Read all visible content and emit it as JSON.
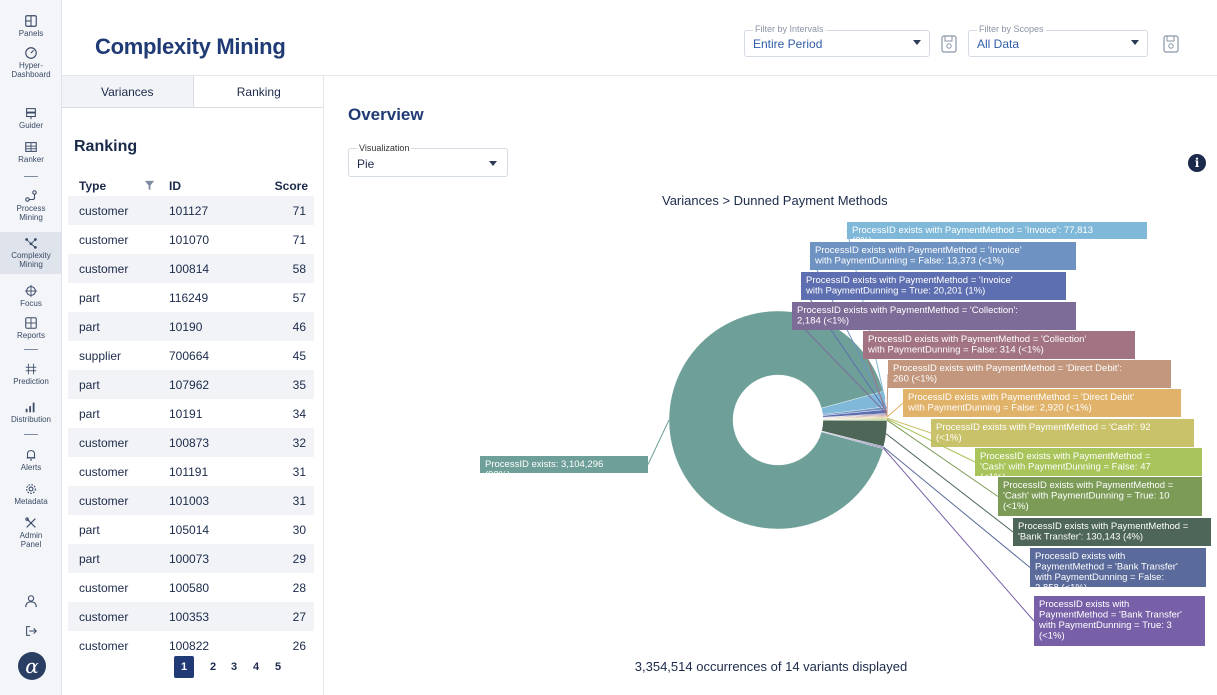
{
  "sidebar": {
    "items": [
      {
        "label": "Panels",
        "icon": "panels-icon"
      },
      {
        "label": "Hyper-Dashboard",
        "icon": "gauge-icon"
      },
      {
        "label": "Guider",
        "icon": "signpost-icon"
      },
      {
        "label": "Ranker",
        "icon": "table-icon"
      },
      {
        "label": "Process Mining",
        "icon": "process-icon"
      },
      {
        "label": "Complexity Mining",
        "icon": "network-icon"
      },
      {
        "label": "Focus",
        "icon": "crosshair-icon"
      },
      {
        "label": "Reports",
        "icon": "reports-icon"
      },
      {
        "label": "Prediction",
        "icon": "prediction-icon"
      },
      {
        "label": "Distribution",
        "icon": "bar-chart-icon"
      },
      {
        "label": "Alerts",
        "icon": "bell-icon"
      },
      {
        "label": "Metadata",
        "icon": "gear-icon"
      },
      {
        "label": "Admin Panel",
        "icon": "tools-icon"
      }
    ],
    "logo": "α"
  },
  "header": {
    "title": "Complexity Mining",
    "interval_filter": {
      "label": "Filter by Intervals",
      "value": "Entire Period"
    },
    "scope_filter": {
      "label": "Filter by Scopes",
      "value": "All Data"
    }
  },
  "left_panel": {
    "tabs": [
      "Variances",
      "Ranking"
    ],
    "title": "Ranking",
    "columns": {
      "type": "Type",
      "id": "ID",
      "score": "Score"
    },
    "rows": [
      {
        "type": "customer",
        "id": "101127",
        "score": "71"
      },
      {
        "type": "customer",
        "id": "101070",
        "score": "71"
      },
      {
        "type": "customer",
        "id": "100814",
        "score": "58"
      },
      {
        "type": "part",
        "id": "116249",
        "score": "57"
      },
      {
        "type": "part",
        "id": "10190",
        "score": "46"
      },
      {
        "type": "supplier",
        "id": "700664",
        "score": "45"
      },
      {
        "type": "part",
        "id": "107962",
        "score": "35"
      },
      {
        "type": "part",
        "id": "10191",
        "score": "34"
      },
      {
        "type": "customer",
        "id": "100873",
        "score": "32"
      },
      {
        "type": "customer",
        "id": "101191",
        "score": "31"
      },
      {
        "type": "customer",
        "id": "101003",
        "score": "31"
      },
      {
        "type": "part",
        "id": "105014",
        "score": "30"
      },
      {
        "type": "part",
        "id": "100073",
        "score": "29"
      },
      {
        "type": "customer",
        "id": "100580",
        "score": "28"
      },
      {
        "type": "customer",
        "id": "100353",
        "score": "27"
      },
      {
        "type": "customer",
        "id": "100822",
        "score": "26"
      }
    ],
    "pages": [
      "1",
      "2",
      "3",
      "4",
      "5"
    ],
    "active_page": "1"
  },
  "main": {
    "title": "Overview",
    "visualization": {
      "label": "Visualization",
      "value": "Pie"
    },
    "info_icon": "i",
    "footer": "3,354,514 occurrences of 14 variants displayed"
  },
  "chart_data": {
    "type": "pie",
    "donut": true,
    "title": "Variances > Dunned Payment Methods",
    "slices": [
      {
        "label": "ProcessID exists: 3,104,296 (93%)",
        "value": 3104296,
        "color": "#6e9f98"
      },
      {
        "label": "ProcessID exists with PaymentMethod = 'Invoice': 77,813 (2%)",
        "value": 77813,
        "color": "#7fb8d8"
      },
      {
        "label": "ProcessID exists with PaymentMethod = 'Invoice' with PaymentDunning = False: 13,373 (<1%)",
        "value": 13373,
        "color": "#6e92c2"
      },
      {
        "label": "ProcessID exists with PaymentMethod = 'Invoice' with PaymentDunning = True: 20,201 (1%)",
        "value": 20201,
        "color": "#5d6fb0"
      },
      {
        "label": "ProcessID exists with PaymentMethod = 'Collection': 2,184 (<1%)",
        "value": 2184,
        "color": "#7d6b98"
      },
      {
        "label": "ProcessID exists with PaymentMethod = 'Collection' with PaymentDunning = False: 314 (<1%)",
        "value": 314,
        "color": "#a27382"
      },
      {
        "label": "ProcessID exists with PaymentMethod = 'Direct Debit': 260 (<1%)",
        "value": 260,
        "color": "#c2977e"
      },
      {
        "label": "ProcessID exists with PaymentMethod = 'Direct Debit' with PaymentDunning = False: 2,920 (<1%)",
        "value": 2920,
        "color": "#e0b26a"
      },
      {
        "label": "ProcessID exists with PaymentMethod = 'Cash': 92 (<1%)",
        "value": 92,
        "color": "#c9c26a"
      },
      {
        "label": "ProcessID exists with PaymentMethod = 'Cash' with PaymentDunning = False: 47 (<1%)",
        "value": 47,
        "color": "#a9c45a"
      },
      {
        "label": "ProcessID exists with PaymentMethod = 'Cash' with PaymentDunning = True: 10 (<1%)",
        "value": 10,
        "color": "#7c9b56"
      },
      {
        "label": "ProcessID exists with PaymentMethod = 'Bank Transfer': 130,143 (4%)",
        "value": 130143,
        "color": "#4d6657"
      },
      {
        "label": "ProcessID exists with PaymentMethod = 'Bank Transfer' with PaymentDunning = False: 2,858 (<1%)",
        "value": 2858,
        "color": "#5a6a9a"
      },
      {
        "label": "ProcessID exists with PaymentMethod = 'Bank Transfer' with PaymentDunning = True: 3 (<1%)",
        "value": 3,
        "color": "#7860a8"
      }
    ]
  }
}
